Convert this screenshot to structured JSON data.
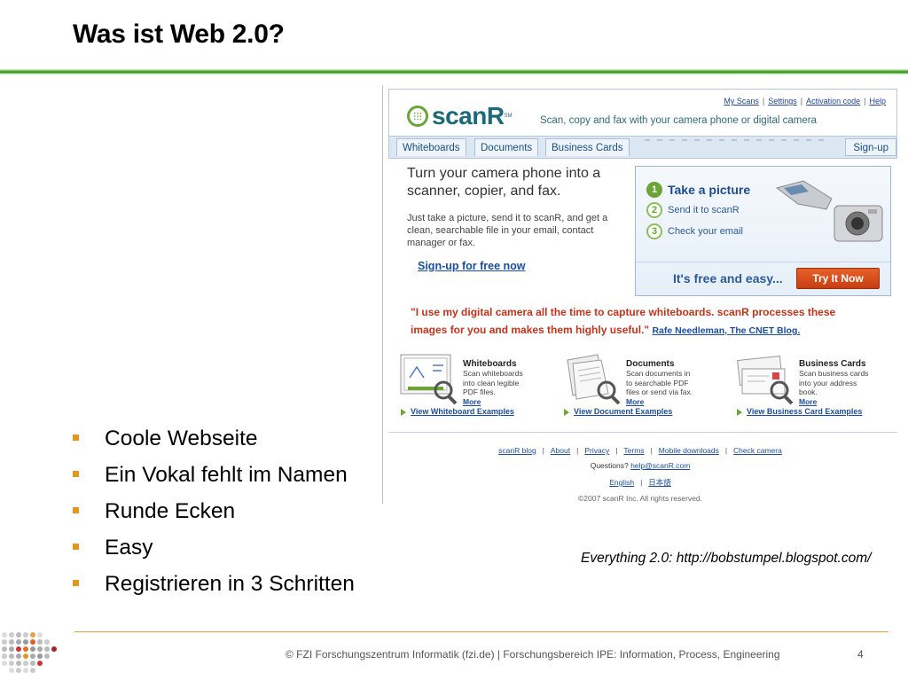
{
  "slide": {
    "title": "Was ist Web 2.0?",
    "bullets": [
      "Coole Webseite",
      "Ein Vokal fehlt im Namen",
      "Runde Ecken",
      "Easy",
      "Registrieren in 3 Schritten"
    ],
    "caption": "Everything 2.0: http://bobstumpel.blogspot.com/",
    "footer": "© FZI Forschungszentrum Informatik (fzi.de) |  Forschungsbereich IPE: Information, Process, Engineering",
    "page_number": "4"
  },
  "site": {
    "logo": "scanR",
    "logo_mark": "SM",
    "tagline": "Scan, copy and fax with your camera phone or digital camera",
    "top_links": [
      "My Scans",
      "Settings",
      "Activation code",
      "Help"
    ],
    "tabs": [
      "Whiteboards",
      "Documents",
      "Business Cards"
    ],
    "signup_tab": "Sign-up",
    "hero_heading": "Turn your camera phone into a scanner, copier, and fax.",
    "hero_text": "Just take a picture, send it to scanR, and get a clean, searchable file in your email, contact manager or fax.",
    "hero_link": "Sign-up for free now",
    "steps": [
      {
        "num": "1",
        "label": "Take a picture"
      },
      {
        "num": "2",
        "label": "Send it to scanR"
      },
      {
        "num": "3",
        "label": "Check your email"
      }
    ],
    "free_text": "It's free and easy...",
    "try_button": "Try It Now",
    "quote": "\"I use my digital camera all the time to capture whiteboards. scanR processes these images for you and makes them highly useful.\"",
    "quote_by": "Rafe Needleman, The CNET Blog.",
    "features": [
      {
        "title": "Whiteboards",
        "desc": "Scan whiteboards into clean legible PDF files.",
        "more": "More",
        "link": "View Whiteboard Examples"
      },
      {
        "title": "Documents",
        "desc": "Scan documents in to searchable PDF files or send via fax.",
        "more": "More",
        "link": "View Document Examples"
      },
      {
        "title": "Business Cards",
        "desc": "Scan business cards into your address book.",
        "more": "More",
        "link": "View Business Card Examples"
      }
    ],
    "footer_links": [
      "scanR blog",
      "About",
      "Privacy",
      "Terms",
      "Mobile downloads",
      "Check camera"
    ],
    "questions_label": "Questions?",
    "questions_email": "help@scanR.com",
    "languages": [
      "English",
      "日本語"
    ],
    "copyright": "©2007 scanR Inc. All rights reserved."
  },
  "colors": {
    "accent_orange": "#e8951c",
    "title_green": "#2e8a14",
    "scanr_teal": "#1a6b7a",
    "link_blue": "#1a4ea0",
    "quote_red": "#c4331a"
  }
}
